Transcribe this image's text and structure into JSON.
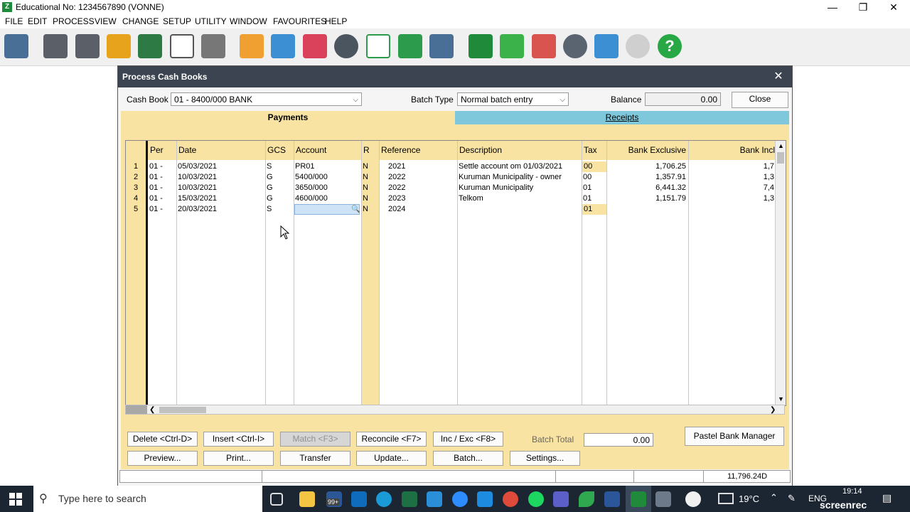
{
  "window": {
    "title": "Educational No: 1234567890 (VONNE)",
    "app_icon_glyph": "Z",
    "minimize_glyph": "—",
    "restore_glyph": "❐",
    "close_glyph": "✕"
  },
  "menu": [
    "FILE",
    "EDIT",
    "PROCESS",
    "VIEW",
    "CHANGE",
    "SETUP",
    "UTILITY",
    "WINDOW",
    "FAVOURITES",
    "HELP"
  ],
  "toolbar_icons": [
    "export-icon",
    "customer-doc-icon",
    "supplier-doc-icon",
    "cash-icon",
    "transfer-icon",
    "text-icon",
    "cash-register-icon",
    "edit-customer-icon",
    "edit-supplier-icon",
    "stock-icon",
    "pie-chart-icon",
    "graph-icon",
    "money-icon",
    "printer-icon",
    "map-icon",
    "lightning-icon",
    "certificate-icon",
    "compass-icon",
    "notepad-icon",
    "chat-icon",
    "help-icon"
  ],
  "dialog": {
    "title": "Process Cash Books",
    "close_glyph": "✕",
    "cash_book_label": "Cash Book",
    "cash_book_value": "01 -  8400/000 BANK",
    "batch_type_label": "Batch Type",
    "batch_type_value": "Normal batch entry",
    "balance_label": "Balance",
    "balance_value": "0.00",
    "close_button": "Close",
    "tab_payments": "Payments",
    "tab_receipts": "Receipts",
    "columns": [
      "Per",
      "Date",
      "GCS",
      "Account",
      "R",
      "Reference",
      "Description",
      "Tax",
      "Bank Exclusive",
      "Bank Incl"
    ],
    "rows": [
      {
        "no": "1",
        "per": "01 -",
        "date": "05/03/2021",
        "gcs": "S",
        "account": "PR01",
        "r": "N",
        "reference": "2021",
        "description": "Settle account om 01/03/2021",
        "tax": "00",
        "excl": "1,706.25",
        "incl": "1,7"
      },
      {
        "no": "2",
        "per": "01 -",
        "date": "10/03/2021",
        "gcs": "G",
        "account": "5400/000",
        "r": "N",
        "reference": "2022",
        "description": "Kuruman Municipality - owner",
        "tax": "00",
        "excl": "1,357.91",
        "incl": "1,3"
      },
      {
        "no": "3",
        "per": "01 -",
        "date": "10/03/2021",
        "gcs": "G",
        "account": "3650/000",
        "r": "N",
        "reference": "2022",
        "description": "Kuruman Municipality",
        "tax": "01",
        "excl": "6,441.32",
        "incl": "7,4"
      },
      {
        "no": "4",
        "per": "01 -",
        "date": "15/03/2021",
        "gcs": "G",
        "account": "4600/000",
        "r": "N",
        "reference": "2023",
        "description": "Telkom",
        "tax": "01",
        "excl": "1,151.79",
        "incl": "1,3"
      },
      {
        "no": "5",
        "per": "01 -",
        "date": "20/03/2021",
        "gcs": "S",
        "account": "",
        "r": "N",
        "reference": "2024",
        "description": "",
        "tax": "01",
        "excl": "",
        "incl": ""
      }
    ],
    "buttons_row1": [
      "Delete <Ctrl-D>",
      "Insert <Ctrl-I>",
      "Match <F3>",
      "Reconcile <F7>",
      "Inc / Exc <F8>"
    ],
    "buttons_row2": [
      "Preview...",
      "Print...",
      "Transfer",
      "Update...",
      "Batch...",
      "Settings..."
    ],
    "batch_total_label": "Batch Total",
    "batch_total_value": "0.00",
    "bank_manager_button": "Pastel Bank Manager",
    "status_total": "11,796.24D"
  },
  "taskbar": {
    "search_placeholder": "Type here to search",
    "badge": "99+",
    "weather": "19°C",
    "language": "ENG",
    "time": "19:14",
    "watermark": "screenrec"
  },
  "colors": {
    "payments_tab": "#f8e3a3",
    "receipts_tab": "#7fc7da",
    "dialog_title": "#3b4450",
    "taskbar": "#1c2633"
  }
}
